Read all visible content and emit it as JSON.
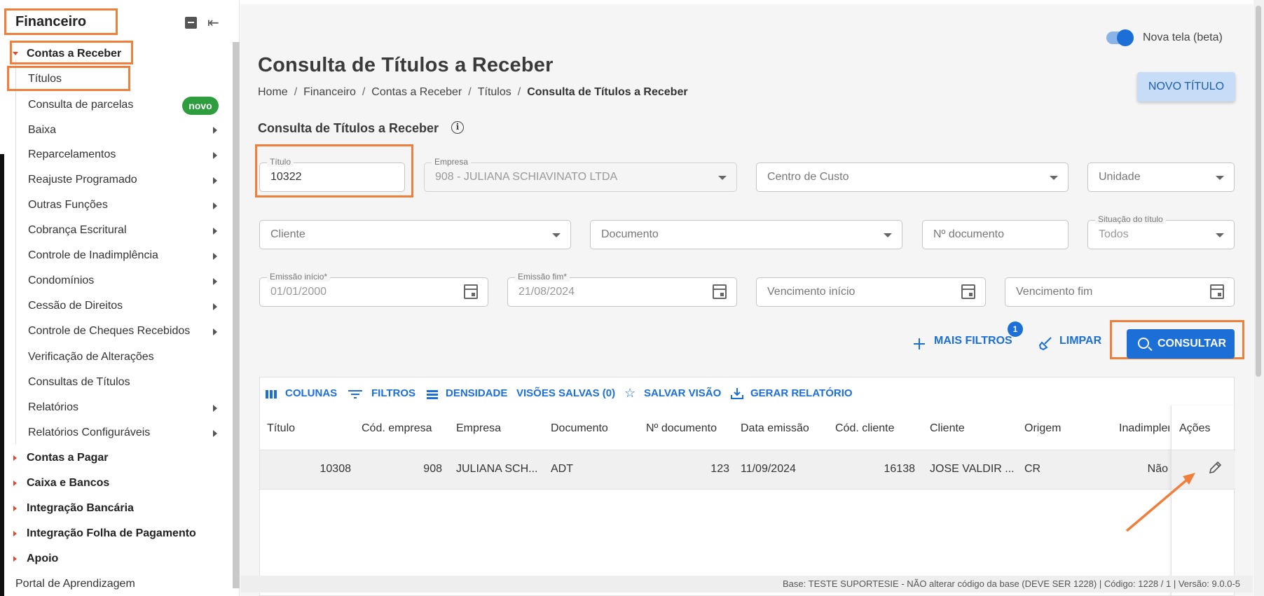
{
  "sidebar": {
    "title": "Financeiro",
    "sections": [
      {
        "label": "Contas a Receber"
      },
      {
        "label": "Contas a Pagar"
      },
      {
        "label": "Caixa e Bancos"
      },
      {
        "label": "Integração Bancária"
      },
      {
        "label": "Integração Folha de Pagamento"
      },
      {
        "label": "Apoio"
      }
    ],
    "items": [
      {
        "label": "Títulos"
      },
      {
        "label": "Consulta de parcelas",
        "badge": "novo"
      },
      {
        "label": "Baixa"
      },
      {
        "label": "Reparcelamentos"
      },
      {
        "label": "Reajuste Programado"
      },
      {
        "label": "Outras Funções"
      },
      {
        "label": "Cobrança Escritural"
      },
      {
        "label": "Controle de Inadimplência"
      },
      {
        "label": "Condomínios"
      },
      {
        "label": "Cessão de Direitos"
      },
      {
        "label": "Controle de Cheques Recebidos"
      },
      {
        "label": "Verificação de Alterações"
      },
      {
        "label": "Consultas de Títulos"
      },
      {
        "label": "Relatórios"
      },
      {
        "label": "Relatórios Configuráveis"
      }
    ],
    "footer": "Portal de Aprendizagem"
  },
  "header": {
    "toggle_label": "Nova tela (beta)",
    "page_title": "Consulta de Títulos a Receber",
    "breadcrumb": [
      "Home",
      "Financeiro",
      "Contas a Receber",
      "Títulos",
      "Consulta de Títulos a Receber"
    ],
    "new_button": "NOVO TÍTULO"
  },
  "form": {
    "section_title": "Consulta de Títulos a Receber",
    "titulo": {
      "label": "Título",
      "value": "10322"
    },
    "empresa": {
      "label": "Empresa",
      "value": "908 - JULIANA SCHIAVINATO LTDA"
    },
    "centro_custo": {
      "placeholder": "Centro de Custo"
    },
    "unidade": {
      "placeholder": "Unidade"
    },
    "cliente": {
      "placeholder": "Cliente"
    },
    "documento": {
      "placeholder": "Documento"
    },
    "n_documento": {
      "placeholder": "Nº documento"
    },
    "situacao": {
      "label": "Situação do título",
      "value": "Todos"
    },
    "emissao_inicio": {
      "label": "Emissão início*",
      "value": "01/01/2000"
    },
    "emissao_fim": {
      "label": "Emissão fim*",
      "value": "21/08/2024"
    },
    "vencimento_inicio": {
      "placeholder": "Vencimento início"
    },
    "vencimento_fim": {
      "placeholder": "Vencimento fim"
    }
  },
  "actions": {
    "mais_filtros": "MAIS FILTROS",
    "mais_filtros_count": "1",
    "limpar": "LIMPAR",
    "consultar": "CONSULTAR"
  },
  "grid": {
    "toolbar": {
      "colunas": "COLUNAS",
      "filtros": "FILTROS",
      "densidade": "DENSIDADE",
      "visoes": "VISÕES SALVAS (0)",
      "salvar": "SALVAR VISÃO",
      "relatorio": "GERAR RELATÓRIO"
    },
    "columns": [
      "Título",
      "Cód. empresa",
      "Empresa",
      "Documento",
      "Nº documento",
      "Data emissão",
      "Cód. cliente",
      "Cliente",
      "Origem",
      "Inadimpler",
      "Ações"
    ],
    "rows": [
      [
        "10308",
        "908",
        "JULIANA SCH...",
        "ADT",
        "123",
        "11/09/2024",
        "16138",
        "JOSE VALDIR ...",
        "CR",
        "Não"
      ]
    ]
  },
  "status": {
    "text": "Base: TESTE SUPORTESIE - NÃO alterar código da base (DEVE SER 1228)  |  Código: 1228 / 1  |  Versão: 9.0.0-5"
  },
  "colors": {
    "primary": "#1b6fd6",
    "highlight": "#f07f3c",
    "badge_green": "#2e9d3d",
    "caret_red": "#e5462f"
  }
}
